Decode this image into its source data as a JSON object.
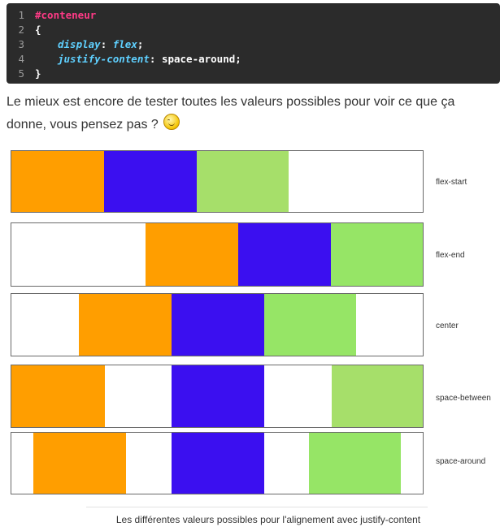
{
  "code": {
    "lines": [
      {
        "num": "1",
        "selector": "#conteneur"
      },
      {
        "num": "2",
        "brace": "{"
      },
      {
        "num": "3",
        "property": "display",
        "value": "flex"
      },
      {
        "num": "4",
        "property": "justify-content",
        "value": "space-around"
      },
      {
        "num": "5",
        "brace": "}"
      }
    ]
  },
  "paragraph": {
    "text": "Le mieux est encore de tester toutes les valeurs possibles pour voir ce que ça donne, vous pensez pas ?",
    "emoji": "smiley-icon"
  },
  "figure": {
    "colors": {
      "orange": "#ff9e00",
      "blue": "#3b0ff0",
      "green_light": "#a6df6a",
      "green": "#96e566"
    },
    "rows": [
      {
        "label": "flex-start"
      },
      {
        "label": "flex-end"
      },
      {
        "label": "center"
      },
      {
        "label": "space-between"
      },
      {
        "label": "space-around"
      }
    ],
    "caption": "Les différentes valeurs possibles pour l'alignement avec justify-content"
  }
}
